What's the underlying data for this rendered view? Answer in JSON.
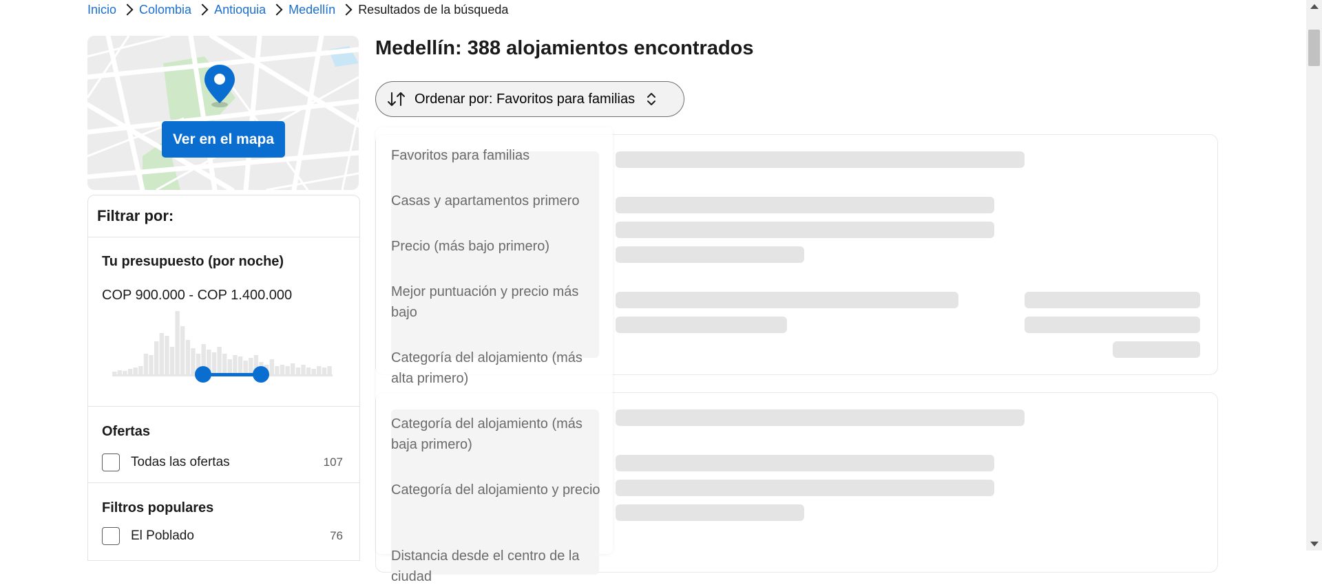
{
  "breadcrumb": {
    "items": [
      "Inicio",
      "Colombia",
      "Antioquia",
      "Medellín"
    ],
    "current": "Resultados de la búsqueda"
  },
  "map": {
    "button_label": "Ver en el mapa"
  },
  "filters": {
    "title": "Filtrar por:",
    "budget": {
      "heading": "Tu presupuesto (por noche)",
      "range": "COP 900.000 - COP 1.400.000"
    },
    "offers": {
      "heading": "Ofertas",
      "options": [
        {
          "label": "Todas las ofertas",
          "count": "107"
        }
      ]
    },
    "popular": {
      "heading": "Filtros populares",
      "options": [
        {
          "label": "El Poblado",
          "count": "76"
        }
      ]
    }
  },
  "results": {
    "title": "Medellín: 388 alojamientos encontrados",
    "sort_label": "Ordenar por: Favoritos para familias"
  },
  "sort_options": [
    "Favoritos para familias",
    "Casas y apartamentos primero",
    "Precio (más bajo primero)",
    "Mejor puntuación y precio más bajo",
    "Categoría del alojamiento (más alta primero)",
    "Categoría del alojamiento (más baja primero)",
    "Categoría del alojamiento y precio",
    "Distancia desde el centro de la ciudad"
  ],
  "colors": {
    "accent": "#0a6ed1",
    "link": "#1a6fd1",
    "skeleton": "#e4e4e4"
  }
}
